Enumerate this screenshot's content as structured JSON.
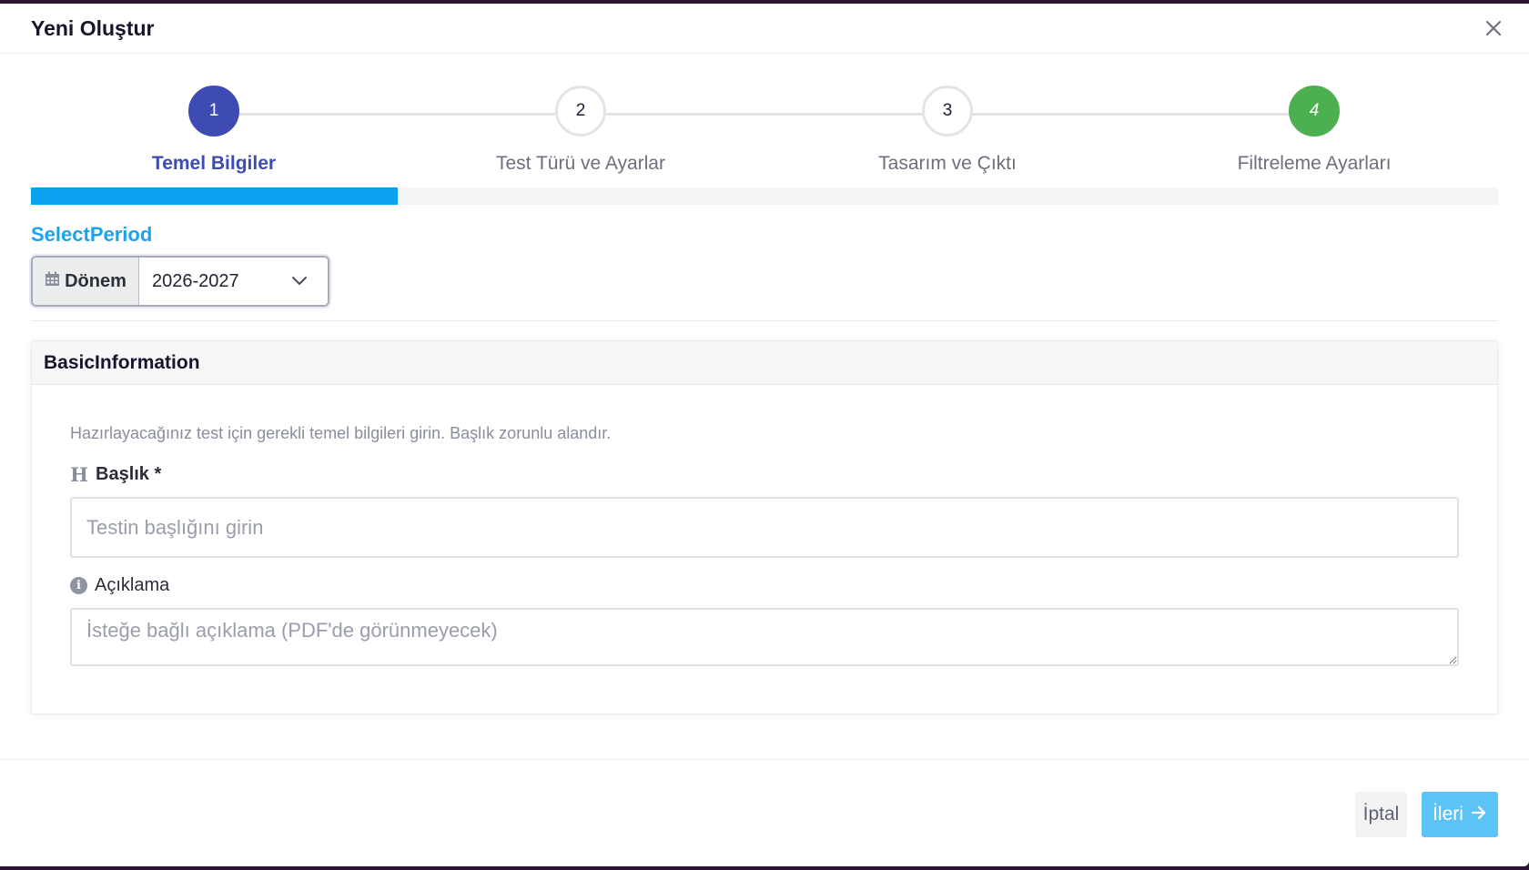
{
  "modal": {
    "title": "Yeni Oluştur",
    "close_icon": "close-icon"
  },
  "stepper": {
    "steps": [
      {
        "number": "1",
        "label": "Temel Bilgiler",
        "state": "active"
      },
      {
        "number": "2",
        "label": "Test Türü ve Ayarlar",
        "state": "pending"
      },
      {
        "number": "3",
        "label": "Tasarım ve Çıktı",
        "state": "pending"
      },
      {
        "number": "4",
        "label": "Filtreleme Ayarları",
        "state": "done"
      }
    ],
    "progress_fraction": 0.25
  },
  "period": {
    "section_label": "SelectPeriod",
    "addon_icon": "calendar-icon",
    "addon_label": "Dönem",
    "selected_value": "2026-2027"
  },
  "basic_info": {
    "header": "BasicInformation",
    "description": "Hazırlayacağınız test için gerekli temel bilgileri girin. Başlık zorunlu alandır.",
    "title_field": {
      "icon": "heading-icon",
      "icon_glyph": "H",
      "label": "Başlık *",
      "value": "",
      "placeholder": "Testin başlığını girin"
    },
    "description_field": {
      "icon": "info-icon",
      "icon_glyph": "i",
      "label": "Açıklama",
      "value": "",
      "placeholder": "İsteğe bağlı açıklama (PDF'de görünmeyecek)"
    }
  },
  "footer": {
    "cancel_label": "İptal",
    "next_label": "İleri",
    "next_icon": "arrow-right-icon"
  },
  "colors": {
    "active_step": "#3e4bb3",
    "done_step": "#4caf50",
    "progress": "#0ba1ef",
    "next_button": "#5bc3f6",
    "section_label": "#1aa3ef"
  }
}
